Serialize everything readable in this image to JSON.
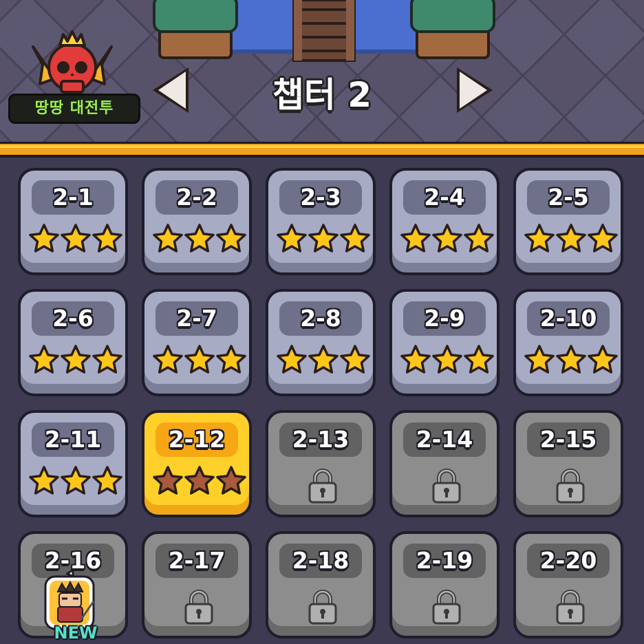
{
  "header": {
    "chapter_title": "챕터 2",
    "battle_label": "땅땅 대전투"
  },
  "stages": [
    {
      "label": "2-1",
      "state": "cleared",
      "stars": 3
    },
    {
      "label": "2-2",
      "state": "cleared",
      "stars": 3
    },
    {
      "label": "2-3",
      "state": "cleared",
      "stars": 3
    },
    {
      "label": "2-4",
      "state": "cleared",
      "stars": 3
    },
    {
      "label": "2-5",
      "state": "cleared",
      "stars": 3
    },
    {
      "label": "2-6",
      "state": "cleared",
      "stars": 3
    },
    {
      "label": "2-7",
      "state": "cleared",
      "stars": 3
    },
    {
      "label": "2-8",
      "state": "cleared",
      "stars": 3
    },
    {
      "label": "2-9",
      "state": "cleared",
      "stars": 3
    },
    {
      "label": "2-10",
      "state": "cleared",
      "stars": 3
    },
    {
      "label": "2-11",
      "state": "cleared",
      "stars": 3
    },
    {
      "label": "2-12",
      "state": "current",
      "stars": 0
    },
    {
      "label": "2-13",
      "state": "locked",
      "stars": 0
    },
    {
      "label": "2-14",
      "state": "locked",
      "stars": 0
    },
    {
      "label": "2-15",
      "state": "locked",
      "stars": 0
    },
    {
      "label": "2-16",
      "state": "locked",
      "stars": 0
    },
    {
      "label": "2-17",
      "state": "locked",
      "stars": 0
    },
    {
      "label": "2-18",
      "state": "locked",
      "stars": 0
    },
    {
      "label": "2-19",
      "state": "locked",
      "stars": 0
    },
    {
      "label": "2-20",
      "state": "locked",
      "stars": 0
    }
  ],
  "new_badge": {
    "text": "NEW",
    "icon": "samurai-character-icon"
  },
  "icons": {
    "battle": "crowned-skull-icon",
    "prev": "arrow-left-icon",
    "next": "arrow-right-icon",
    "star": "star-icon",
    "lock": "padlock-icon"
  },
  "colors": {
    "star_filled": "#ffc61a",
    "star_empty": "#a85a3a",
    "tile_cleared": "#a8abc4",
    "tile_current": "#ffd02a",
    "tile_locked": "#8d8d8d",
    "divider": "#f3a21b",
    "battle_label_text": "#9cf050"
  }
}
